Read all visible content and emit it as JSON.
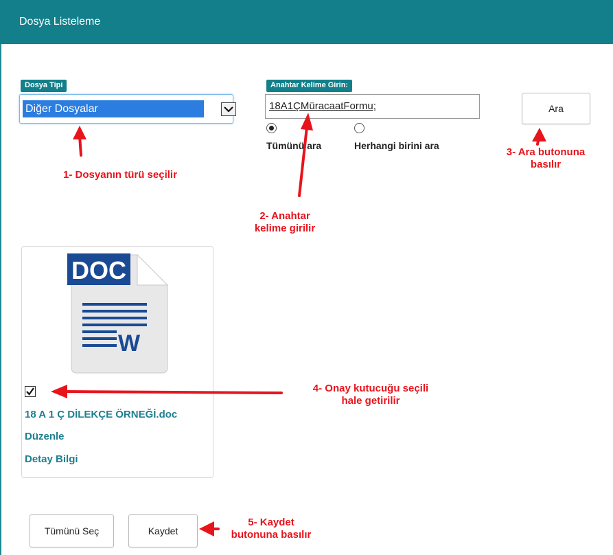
{
  "header": {
    "title": "Dosya Listeleme"
  },
  "file_type": {
    "label": "Dosya Tipi",
    "selected": "Diğer Dosyalar"
  },
  "keyword": {
    "label": "Anahtar Kelime Girin:",
    "value": "18A1ÇMüracaatFormu;"
  },
  "search_mode": {
    "options": [
      "Tümünü ara",
      "Herhangi birini ara"
    ],
    "selected_index": 0
  },
  "search_button": {
    "label": "Ara"
  },
  "file_card": {
    "icon_text": "DOC",
    "icon_letter": "W",
    "checked": true,
    "file_name": "18 A 1 Ç DİLEKÇE ÖRNEĞİ.doc",
    "edit_link": "Düzenle",
    "detail_link": "Detay Bilgi"
  },
  "footer": {
    "select_all_label": "Tümünü Seç",
    "save_label": "Kaydet"
  },
  "annotations": {
    "step1": "1- Dosyanın türü seçilir",
    "step2_line1": "2- Anahtar",
    "step2_line2": "kelime girilir",
    "step3_line1": "3- Ara butonuna",
    "step3_line2": "basılır",
    "step4_line1": "4- Onay kutucuğu seçili",
    "step4_line2": "hale getirilir",
    "step5_line1": "5- Kaydet",
    "step5_line2": "butonuna basılır"
  },
  "colors": {
    "header": "#137f8a",
    "annotation": "#e8141c",
    "link": "#1d7f8f",
    "select_highlight": "#2b7de0"
  }
}
